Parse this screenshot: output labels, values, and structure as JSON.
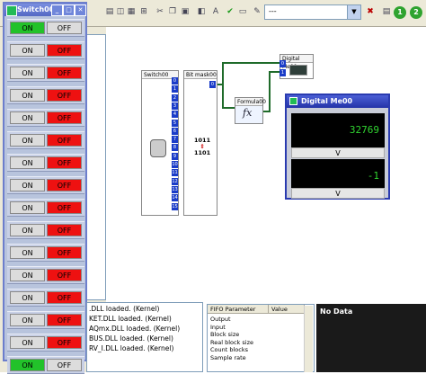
{
  "toolbar": {
    "icons": [
      "open-folder",
      "new-window",
      "grid",
      "align",
      "cut",
      "copy",
      "paste",
      "layers",
      "text",
      "checkmark",
      "screen",
      "tool"
    ],
    "dropdown_value": "---",
    "circle1": "1",
    "circle2": "2"
  },
  "switch_window": {
    "title": "Switch00",
    "on_label": "ON",
    "off_label": "OFF",
    "rows": [
      {
        "on_active": true
      },
      {
        "on_active": false
      },
      {
        "on_active": false
      },
      {
        "on_active": false
      },
      {
        "on_active": false
      },
      {
        "on_active": false
      },
      {
        "on_active": false
      },
      {
        "on_active": false
      },
      {
        "on_active": false
      },
      {
        "on_active": false
      },
      {
        "on_active": false
      },
      {
        "on_active": false
      },
      {
        "on_active": false
      },
      {
        "on_active": false
      },
      {
        "on_active": false
      },
      {
        "on_active": true
      }
    ],
    "colors": {
      "on_active": "#22c22a",
      "off_active": "#ee1111",
      "inactive": "#dcdcdc"
    }
  },
  "canvas": {
    "switch_block_title": "Switch00",
    "bitmask_block_title": "Bit mask00",
    "bitmask_bits_top": "1011",
    "bitmask_bits_bottom": "1101",
    "formula_title": "Formula00",
    "formula_symbol": "fx",
    "digital_meter_block_title": "Digital Me00",
    "input_ports": [
      "0",
      "1",
      "2",
      "3",
      "4",
      "5",
      "6",
      "7",
      "8",
      "9",
      "10",
      "11",
      "12",
      "13",
      "14",
      "15"
    ]
  },
  "digital_meter": {
    "title": "Digital Me00",
    "value1": "32769",
    "unit1": "V",
    "value2": "-1",
    "unit2": "V"
  },
  "log": {
    "lines": [
      ".DLL loaded. (Kernel)",
      "KET.DLL loaded. (Kernel)",
      "AQmx.DLL loaded. (Kernel)",
      "BUS.DLL loaded. (Kernel)",
      "RV_I.DLL loaded. (Kernel)"
    ]
  },
  "fifo": {
    "headers": [
      "FIFO Parameter",
      "Value"
    ],
    "rows": [
      "Output",
      "Input",
      "Block size",
      "Real block size",
      "Count blocks",
      "Sample rate"
    ]
  },
  "status_panel": {
    "text": "No Data"
  }
}
